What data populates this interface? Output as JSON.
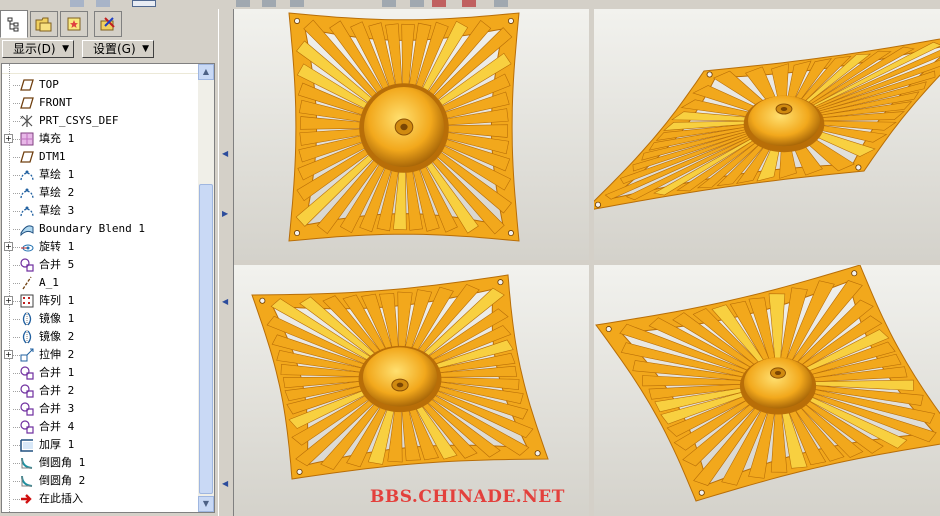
{
  "menus": {
    "display_label": "显示(D)",
    "settings_label": "设置(G)"
  },
  "tree": {
    "items": [
      {
        "label": "TOP",
        "icon": "datum-plane-icon",
        "expandable": false
      },
      {
        "label": "FRONT",
        "icon": "datum-plane-icon",
        "expandable": false
      },
      {
        "label": "PRT_CSYS_DEF",
        "icon": "coordinate-system-icon",
        "expandable": false
      },
      {
        "label": "填充 1",
        "icon": "fill-surface-icon",
        "expandable": true
      },
      {
        "label": "DTM1",
        "icon": "datum-plane-icon",
        "expandable": false
      },
      {
        "label": "草绘 1",
        "icon": "sketch-icon",
        "expandable": false
      },
      {
        "label": "草绘 2",
        "icon": "sketch-icon",
        "expandable": false
      },
      {
        "label": "草绘 3",
        "icon": "sketch-icon",
        "expandable": false
      },
      {
        "label": "Boundary Blend 1",
        "icon": "boundary-blend-icon",
        "expandable": false
      },
      {
        "label": "旋转 1",
        "icon": "revolve-icon",
        "expandable": true
      },
      {
        "label": "合并 5",
        "icon": "merge-icon",
        "expandable": false
      },
      {
        "label": "A_1",
        "icon": "datum-axis-icon",
        "expandable": false
      },
      {
        "label": "阵列 1",
        "icon": "pattern-icon",
        "expandable": true
      },
      {
        "label": "镜像 1",
        "icon": "mirror-icon",
        "expandable": false
      },
      {
        "label": "镜像 2",
        "icon": "mirror-icon",
        "expandable": false
      },
      {
        "label": "拉伸 2",
        "icon": "extrude-icon",
        "expandable": true
      },
      {
        "label": "合并 1",
        "icon": "merge-icon",
        "expandable": false
      },
      {
        "label": "合并 2",
        "icon": "merge-icon",
        "expandable": false
      },
      {
        "label": "合并 3",
        "icon": "merge-icon",
        "expandable": false
      },
      {
        "label": "合并 4",
        "icon": "merge-icon",
        "expandable": false
      },
      {
        "label": "加厚 1",
        "icon": "thicken-icon",
        "expandable": false
      },
      {
        "label": "倒圆角 1",
        "icon": "round-icon",
        "expandable": false
      },
      {
        "label": "倒圆角 2",
        "icon": "round-icon",
        "expandable": false
      },
      {
        "label": "在此插入",
        "icon": "insert-here-arrow-icon",
        "expandable": false
      }
    ]
  },
  "colors": {
    "model_orange": "#f2a81c",
    "model_dark": "#b86e08",
    "insert_arrow": "#d01010",
    "watermark": "#e3403c"
  },
  "watermark": "BBS.CHINADE.NET"
}
